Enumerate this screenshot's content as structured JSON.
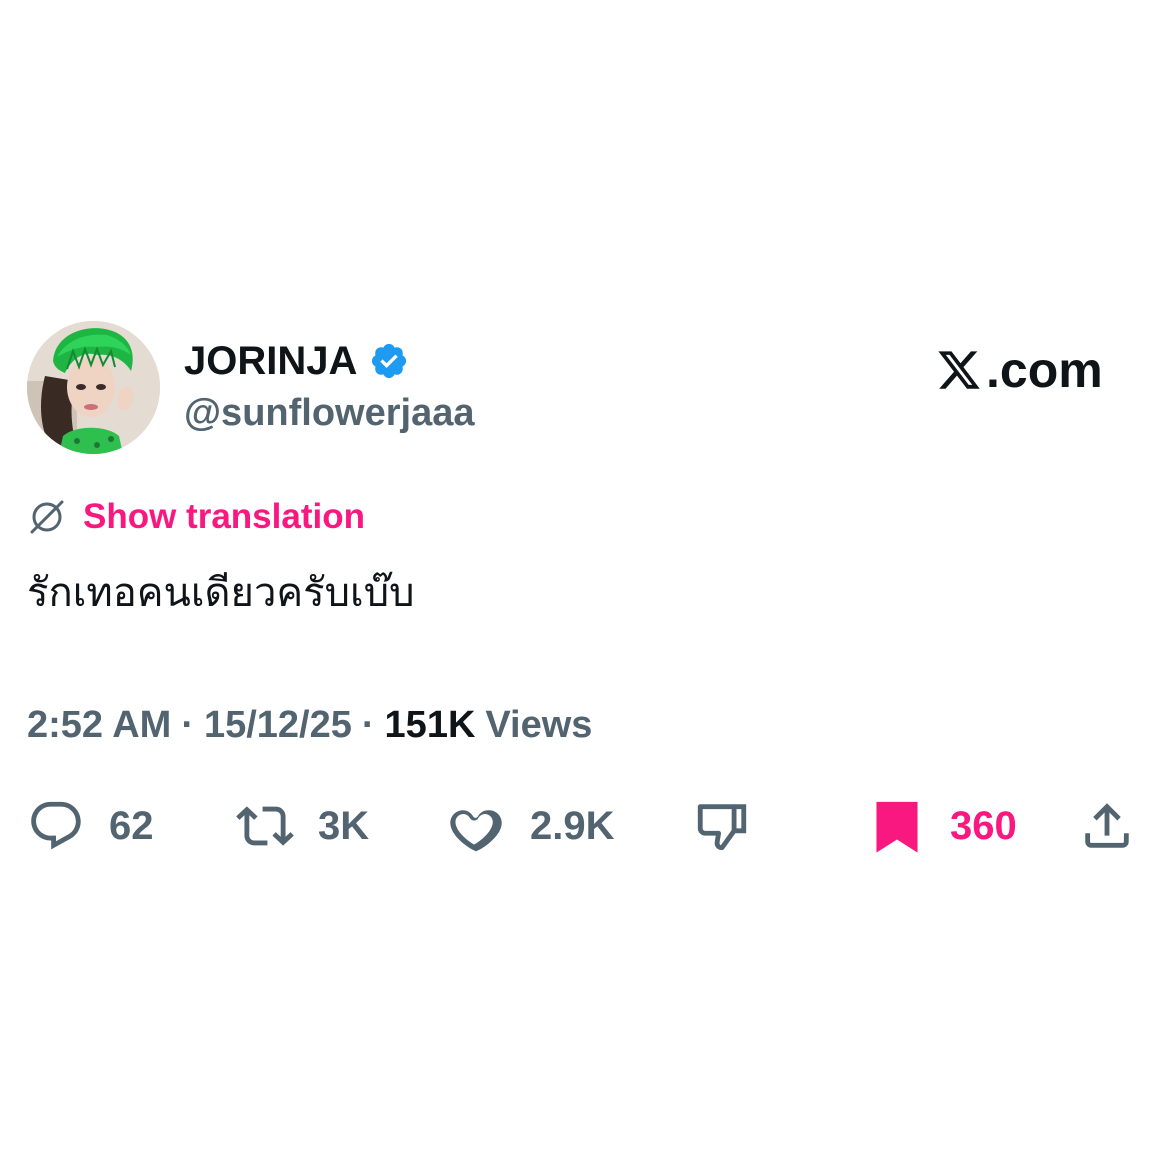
{
  "author": {
    "display_name": "JORINJA",
    "handle": "@sunflowerjaaa",
    "verified": true
  },
  "brand": {
    "label": ".com",
    "icon": "x-logo-icon"
  },
  "translation": {
    "label": "Show translation",
    "icon": "globe-icon"
  },
  "tweet": {
    "text": "รักเทอคนเดียวครับเบ๊บ"
  },
  "meta": {
    "time": "2:52 AM",
    "separator": "·",
    "date": "15/12/25",
    "views_count": "151K",
    "views_label": "Views"
  },
  "actions": {
    "reply": {
      "icon": "reply-icon",
      "count": "62"
    },
    "repost": {
      "icon": "repost-icon",
      "count": "3K"
    },
    "like": {
      "icon": "heart-icon",
      "count": "2.9K"
    },
    "dislike": {
      "icon": "thumbs-down-icon"
    },
    "bookmark": {
      "icon": "bookmark-icon",
      "count": "360"
    },
    "share": {
      "icon": "share-icon"
    }
  },
  "colors": {
    "accent": "#f91880",
    "verified": "#1d9bf0",
    "muted": "#536471",
    "text": "#0f1419"
  }
}
